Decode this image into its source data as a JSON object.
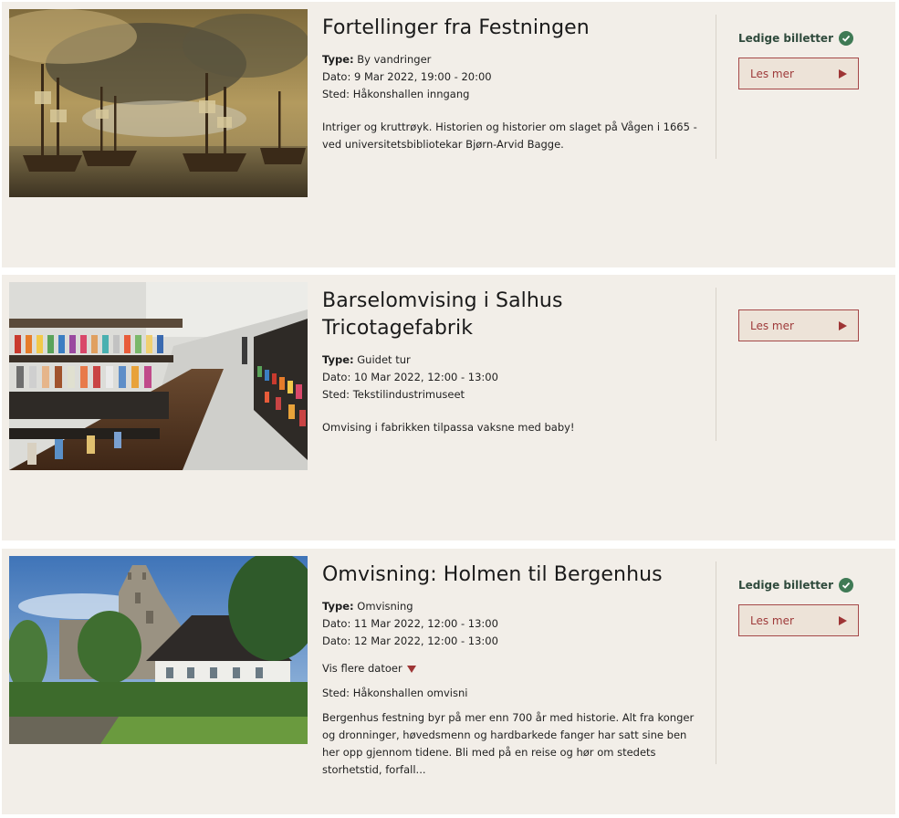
{
  "events": [
    {
      "title": "Fortellinger fra Festningen",
      "type_label": "Type:",
      "type_value": "By vandringer",
      "dates": [
        "Dato: 9 Mar 2022, 19:00 - 20:00"
      ],
      "location": "Sted: Håkonshallen inngang",
      "description": "Intriger og kruttrøyk. Historien og historier om slaget på Vågen i 1665 - ved universitetsbibliotekar Bjørn-Arvid Bagge.",
      "availability": "Ledige billetter",
      "button_label": "Les mer"
    },
    {
      "title": "Barselomvising i Salhus Tricotagefabrik",
      "type_label": "Type:",
      "type_value": "Guidet tur",
      "dates": [
        "Dato: 10 Mar 2022, 12:00 - 13:00"
      ],
      "location": "Sted: Tekstilindustrimuseet",
      "description": "Omvising i fabrikken tilpassa vaksne med baby!",
      "button_label": "Les mer"
    },
    {
      "title": "Omvisning: Holmen til Bergenhus",
      "type_label": "Type:",
      "type_value": "Omvisning",
      "dates": [
        "Dato: 11 Mar 2022, 12:00 - 13:00",
        "Dato: 12 Mar 2022, 12:00 - 13:00"
      ],
      "more_dates_label": "Vis flere datoer",
      "location": "Sted: Håkonshallen omvisni",
      "description": "Bergenhus festning byr på mer enn 700 år med historie. Alt fra konger og dronninger, høvedsmenn og hardbarkede fanger har satt sine ben her opp gjennom tidene. Bli med på en reise og hør om stedets storhetstid, forfall...",
      "availability": "Ledige billetter",
      "button_label": "Les mer"
    }
  ],
  "colors": {
    "card_bg": "#f2eee8",
    "accent_red": "#9e3535",
    "available_green": "#3f7a55"
  },
  "icons": {
    "check": "check-circle-icon",
    "arrow_right": "play-arrow-icon",
    "arrow_down": "caret-down-icon"
  }
}
